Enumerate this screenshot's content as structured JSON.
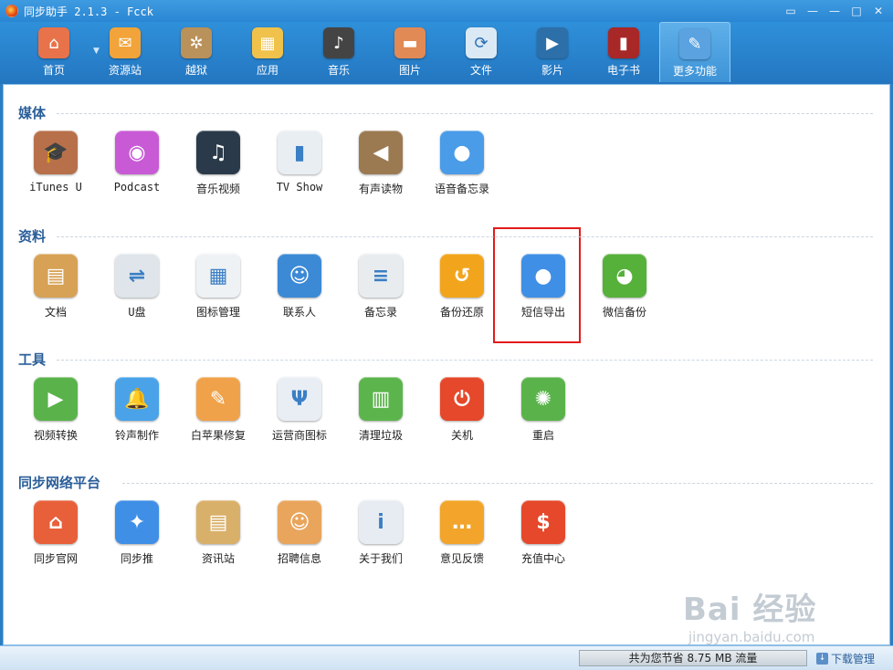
{
  "window": {
    "title": "同步助手 2.1.3 - Fcck",
    "controls": [
      "▭",
      "—",
      "—",
      "□",
      "✕"
    ]
  },
  "toolbar": [
    {
      "label": "首页",
      "icon": "home-icon",
      "color": "#e8734a"
    },
    {
      "label": "资源站",
      "icon": "shopping-bag-icon",
      "color": "#f2a43a"
    },
    {
      "label": "越狱",
      "icon": "pineapple-icon",
      "color": "#b9915a"
    },
    {
      "label": "应用",
      "icon": "apps-grid-icon",
      "color": "#f0c24b"
    },
    {
      "label": "音乐",
      "icon": "music-note-icon",
      "color": "#444444"
    },
    {
      "label": "图片",
      "icon": "photo-icon",
      "color": "#e28a55"
    },
    {
      "label": "文件",
      "icon": "folder-sync-icon",
      "color": "#dbe9f5"
    },
    {
      "label": "影片",
      "icon": "video-play-icon",
      "color": "#2d6fa8"
    },
    {
      "label": "电子书",
      "icon": "book-icon",
      "color": "#a82727"
    },
    {
      "label": "更多功能",
      "icon": "tools-icon",
      "color": "#5aa2e0"
    }
  ],
  "sections": [
    {
      "title": "媒体",
      "items": [
        {
          "label": "iTunes U",
          "icon": "graduation-cap-icon",
          "color": "#b8704a"
        },
        {
          "label": "Podcast",
          "icon": "podcast-icon",
          "color": "#c85ad6"
        },
        {
          "label": "音乐视频",
          "icon": "music-video-icon",
          "color": "#2a3a4a"
        },
        {
          "label": "TV Show",
          "icon": "tv-icon",
          "color": "#e9eef3"
        },
        {
          "label": "有声读物",
          "icon": "audiobook-icon",
          "color": "#9b7a52"
        },
        {
          "label": "语音备忘录",
          "icon": "microphone-icon",
          "color": "#4a9be8"
        }
      ]
    },
    {
      "title": "资料",
      "items": [
        {
          "label": "文档",
          "icon": "document-icon",
          "color": "#d7a255"
        },
        {
          "label": "U盘",
          "icon": "usb-drive-icon",
          "color": "#dfe5ea"
        },
        {
          "label": "图标管理",
          "icon": "icon-grid-icon",
          "color": "#eef2f5"
        },
        {
          "label": "联系人",
          "icon": "contacts-icon",
          "color": "#3c8ad6"
        },
        {
          "label": "备忘录",
          "icon": "notes-icon",
          "color": "#e8ecef"
        },
        {
          "label": "备份还原",
          "icon": "backup-restore-icon",
          "color": "#f2a51c"
        },
        {
          "label": "短信导出",
          "icon": "message-bubble-icon",
          "color": "#3f8fe6"
        },
        {
          "label": "微信备份",
          "icon": "wechat-icon",
          "color": "#55b13a"
        }
      ]
    },
    {
      "title": "工具",
      "items": [
        {
          "label": "视频转换",
          "icon": "video-convert-icon",
          "color": "#5ab34a"
        },
        {
          "label": "铃声制作",
          "icon": "bell-icon",
          "color": "#4aa3e8"
        },
        {
          "label": "白苹果修复",
          "icon": "wrench-icon",
          "color": "#f0a24a"
        },
        {
          "label": "运营商图标",
          "icon": "antenna-icon",
          "color": "#e9eef5"
        },
        {
          "label": "清理垃圾",
          "icon": "trash-icon",
          "color": "#5cb54c"
        },
        {
          "label": "关机",
          "icon": "power-icon",
          "color": "#e5482a"
        },
        {
          "label": "重启",
          "icon": "restart-icon",
          "color": "#5ab34a"
        }
      ]
    },
    {
      "title": "同步网络平台",
      "items": [
        {
          "label": "同步官网",
          "icon": "home-icon",
          "color": "#e8603a"
        },
        {
          "label": "同步推",
          "icon": "sync-push-icon",
          "color": "#3f8fe6"
        },
        {
          "label": "资讯站",
          "icon": "news-icon",
          "color": "#d9b06a"
        },
        {
          "label": "招聘信息",
          "icon": "people-icon",
          "color": "#e9a55c"
        },
        {
          "label": "关于我们",
          "icon": "info-icon",
          "color": "#e6ecf2"
        },
        {
          "label": "意见反馈",
          "icon": "feedback-icon",
          "color": "#f2a52a"
        },
        {
          "label": "充值中心",
          "icon": "dollar-icon",
          "color": "#e5482a"
        }
      ]
    }
  ],
  "status": {
    "traffic": "共为您节省 8.75 MB 流量",
    "download": "下载管理"
  },
  "watermark": {
    "main": "Bai 经验",
    "sub": "jingyan.baidu.com"
  }
}
